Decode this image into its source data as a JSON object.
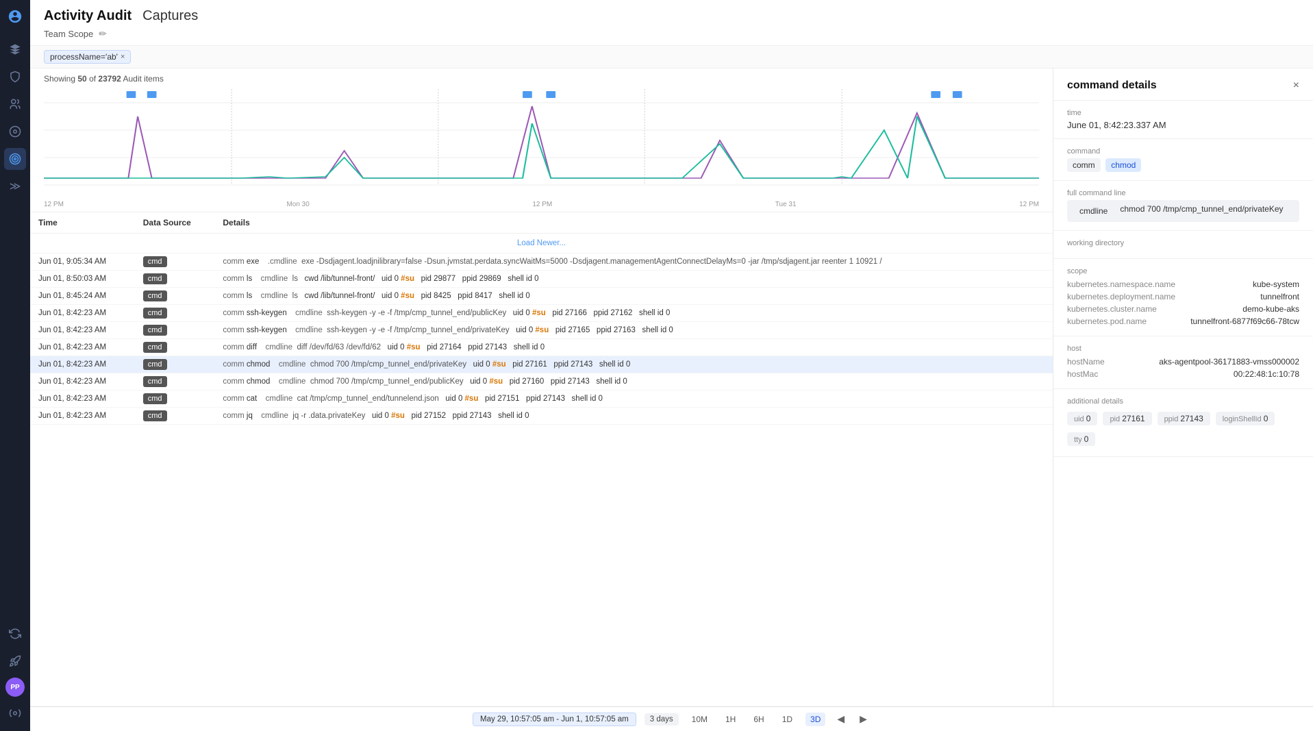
{
  "sidebar": {
    "logo": "⬡",
    "avatar": "PP",
    "items": [
      {
        "name": "layers-icon",
        "icon": "⬡",
        "active": false
      },
      {
        "name": "shield-icon",
        "icon": "🛡",
        "active": false
      },
      {
        "name": "users-icon",
        "icon": "◎",
        "active": false
      },
      {
        "name": "capture-icon",
        "icon": "⊙",
        "active": false
      },
      {
        "name": "target-icon",
        "icon": "◉",
        "active": true
      },
      {
        "name": "more-icon",
        "icon": "≫",
        "active": false
      },
      {
        "name": "recycle-icon",
        "icon": "↻",
        "active": false
      },
      {
        "name": "rocket-icon",
        "icon": "⚡",
        "active": false
      },
      {
        "name": "settings-icon",
        "icon": "⚙",
        "active": false
      }
    ]
  },
  "header": {
    "title": "Activity Audit",
    "subtitle": "Captures",
    "scope_label": "Team Scope",
    "edit_icon": "✏"
  },
  "filter": {
    "tag": "processName='ab'",
    "close": "×"
  },
  "showing": {
    "prefix": "Showing ",
    "count": "50",
    "middle": " of ",
    "total": "23792",
    "suffix": " Audit items"
  },
  "chart": {
    "x_labels": [
      "12 PM",
      "Mon 30",
      "12 PM",
      "Tue 31",
      "12 PM"
    ]
  },
  "table": {
    "columns": [
      "Time",
      "Data Source",
      "Details"
    ],
    "load_newer": "Load Newer...",
    "rows": [
      {
        "time": "Jun 01, 9:05:34 AM",
        "source": "cmd",
        "details": "comm exe  .cmdline  exe -Dsdjagent.loadjnilibrary=false -Dsun.jvmstat.perdata.syncWaitMs=5000 -Dsdjagent.managementAgentConnectDelayMs=0 -jar /tmp/sdjagent.jar reenter 1 10921 /"
      },
      {
        "time": "Jun 01, 8:50:03 AM",
        "source": "cmd",
        "details": "comm ls  cmdline ls   cwd /lib/tunnel-front/   uid 0 #su  pid 29877   ppid 29869   shell id 0"
      },
      {
        "time": "Jun 01, 8:45:24 AM",
        "source": "cmd",
        "details": "comm ls  cmdline ls   cwd /lib/tunnel-front/   uid 0 #su  pid 8425   ppid 8417   shell id 0"
      },
      {
        "time": "Jun 01, 8:42:23 AM",
        "source": "cmd",
        "details": "comm ssh-keygen  cmdline ssh-keygen -y -e -f /tmp/cmp_tunnel_end/publicKey   uid 0 #su  pid 27166   ppid 27162   shell id 0"
      },
      {
        "time": "Jun 01, 8:42:23 AM",
        "source": "cmd",
        "details": "comm ssh-keygen  cmdline ssh-keygen -y -e -f /tmp/cmp_tunnel_end/privateKey   uid 0 #su  pid 27165   ppid 27163   shell id 0"
      },
      {
        "time": "Jun 01, 8:42:23 AM",
        "source": "cmd",
        "details": "comm diff  cmdline diff /dev/fd/63 /dev/fd/62   uid 0 #su  pid 27164   ppid 27143   shell id 0"
      },
      {
        "time": "Jun 01, 8:42:23 AM",
        "source": "cmd",
        "details": "comm chmod  cmdline chmod 700 /tmp/cmp_tunnel_end/privateKey   uid 0 #su  pid 27161   ppid 27143   shell id 0",
        "selected": true
      },
      {
        "time": "Jun 01, 8:42:23 AM",
        "source": "cmd",
        "details": "comm chmod  cmdline chmod 700 /tmp/cmp_tunnel_end/publicKey   uid 0 #su  pid 27160   ppid 27143   shell id 0"
      },
      {
        "time": "Jun 01, 8:42:23 AM",
        "source": "cmd",
        "details": "comm cat  cmdline cat /tmp/cmp_tunnel_end/tunnelend.json   uid 0 #su  pid 27151   ppid 27143   shell id 0"
      },
      {
        "time": "Jun 01, 8:42:23 AM",
        "source": "cmd",
        "details": "comm jq  cmdline jq -r .data.privateKey   uid 0 #su  pid 27152   ppid 27143   shell id 0"
      }
    ]
  },
  "command_details": {
    "title": "command details",
    "close": "×",
    "time_label": "time",
    "time_value": "June 01, 8:42:23.337 AM",
    "command_label": "command",
    "command_comm": "comm",
    "command_value": "chmod",
    "full_command_label": "full command line",
    "full_command_cmdline": "cmdline",
    "full_command_value": "chmod 700 /tmp/cmp_tunnel_end/privateKey",
    "working_dir_label": "working directory",
    "scope_label": "scope",
    "scope": [
      {
        "key": "kubernetes.namespace.name",
        "value": "kube-system"
      },
      {
        "key": "kubernetes.deployment.name",
        "value": "tunnelfront"
      },
      {
        "key": "kubernetes.cluster.name",
        "value": "demo-kube-aks"
      },
      {
        "key": "kubernetes.pod.name",
        "value": "tunnelfront-6877f69c66-78tcw"
      }
    ],
    "host_label": "host",
    "host": [
      {
        "key": "hostName",
        "value": "aks-agentpool-36171883-vmss000002"
      },
      {
        "key": "hostMac",
        "value": "00:22:48:1c:10:78"
      }
    ],
    "additional_label": "additional details",
    "uid_label": "uid",
    "uid_value": "0",
    "pid_label": "pid",
    "pid_value": "27161",
    "ppid_label": "ppid",
    "ppid_value": "27143",
    "login_shell_label": "loginShellId",
    "login_shell_value": "0",
    "tty_label": "tty",
    "tty_value": "0"
  },
  "timeline": {
    "range": "May 29, 10:57:05 am - Jun 1, 10:57:05 am",
    "duration": "3 days",
    "buttons": [
      "10M",
      "1H",
      "6H",
      "1D",
      "3D"
    ]
  }
}
